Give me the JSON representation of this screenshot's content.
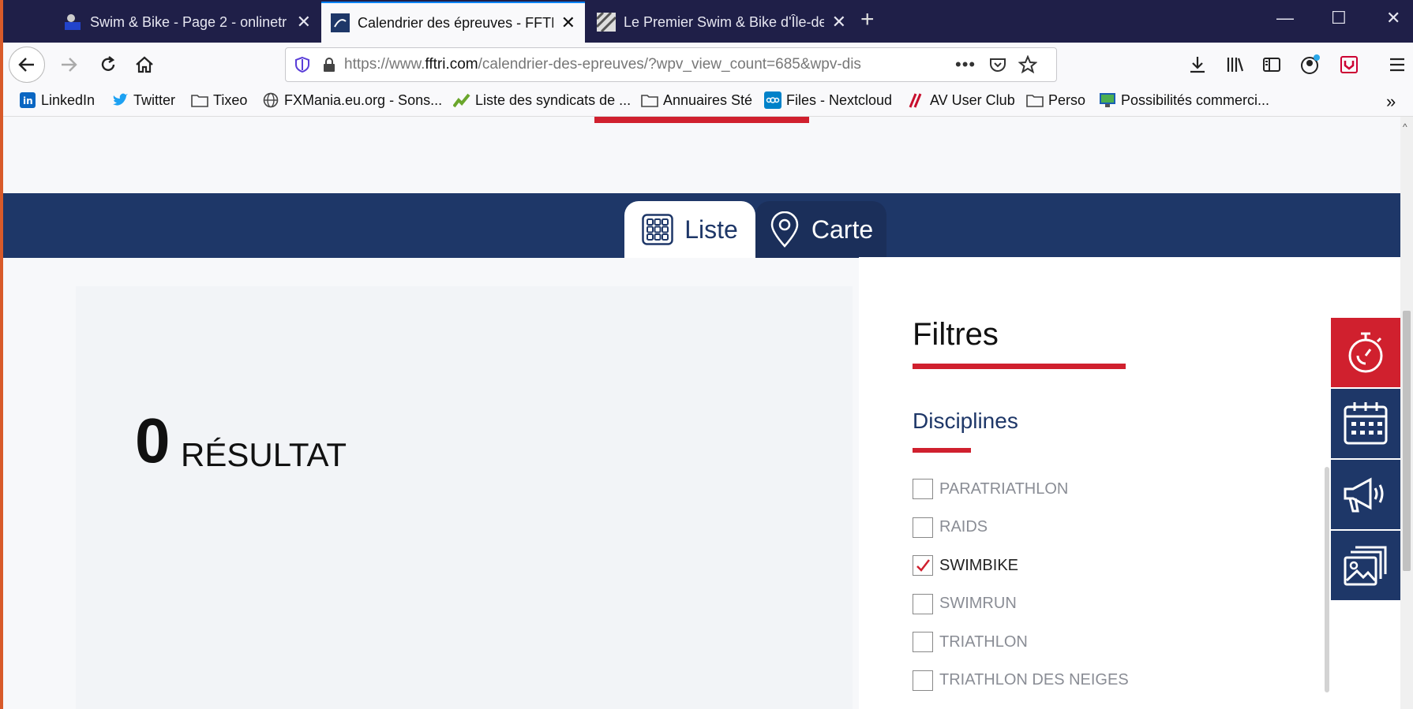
{
  "browser": {
    "tabs": [
      {
        "title": "Swim & Bike - Page 2 - onlinetr",
        "icon": "onlinetri-favicon"
      },
      {
        "title": "Calendrier des épreuves - FFTRI",
        "icon": "fftri-favicon"
      },
      {
        "title": "Le Premier Swim & Bike d'Île-de",
        "icon": "striped-favicon"
      }
    ],
    "url_prefix": "https://www.",
    "url_domain": "fftri.com",
    "url_rest": "/calendrier-des-epreuves/?wpv_view_count=685&wpv-dis",
    "bookmarks": [
      {
        "label": "LinkedIn",
        "icon": "linkedin-icon"
      },
      {
        "label": "Twitter",
        "icon": "twitter-icon"
      },
      {
        "label": "Tixeo",
        "icon": "folder-icon"
      },
      {
        "label": "FXMania.eu.org - Sons...",
        "icon": "globe-icon"
      },
      {
        "label": "Liste des syndicats de ...",
        "icon": "chart-favicon"
      },
      {
        "label": "Annuaires Sté",
        "icon": "folder-icon"
      },
      {
        "label": "Files - Nextcloud",
        "icon": "nextcloud-icon"
      },
      {
        "label": "AV User Club",
        "icon": "avuc-favicon"
      },
      {
        "label": "Perso",
        "icon": "folder-icon"
      },
      {
        "label": "Possibilités commerci...",
        "icon": "monitor-favicon"
      }
    ]
  },
  "page": {
    "view_tabs": {
      "list": "Liste",
      "map": "Carte"
    },
    "results": {
      "count": "0",
      "label": "RÉSULTAT"
    },
    "filters": {
      "title": "Filtres",
      "disciplines_title": "Disciplines",
      "disciplines": [
        {
          "label": "PARATRIATHLON",
          "checked": false
        },
        {
          "label": "RAIDS",
          "checked": false
        },
        {
          "label": "SWIMBIKE",
          "checked": true
        },
        {
          "label": "SWIMRUN",
          "checked": false
        },
        {
          "label": "TRIATHLON",
          "checked": false
        },
        {
          "label": "TRIATHLON DES NEIGES",
          "checked": false
        }
      ]
    },
    "side_buttons": [
      {
        "icon": "stopwatch-icon",
        "color": "#d0202e"
      },
      {
        "icon": "calendar-icon",
        "color": "#1e3768"
      },
      {
        "icon": "megaphone-icon",
        "color": "#1e3768"
      },
      {
        "icon": "gallery-icon",
        "color": "#1e3768"
      }
    ],
    "colors": {
      "brand_blue": "#1e3768",
      "accent_red": "#d0202e"
    }
  }
}
